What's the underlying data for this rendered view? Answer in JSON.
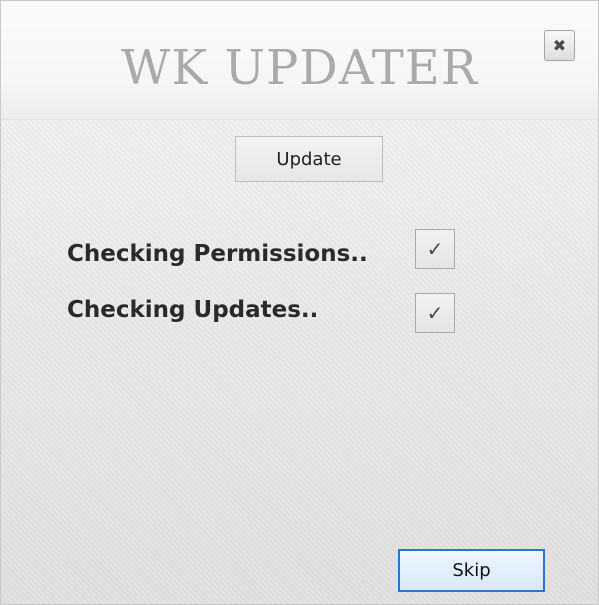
{
  "window": {
    "title": "WK UPDATER",
    "close_icon": "close-icon",
    "close_glyph": "✖"
  },
  "actions": {
    "update_label": "Update",
    "skip_label": "Skip"
  },
  "status": [
    {
      "label": "Checking Permissions..",
      "checked": true,
      "check_glyph": "✓"
    },
    {
      "label": "Checking Updates..",
      "checked": true,
      "check_glyph": "✓"
    }
  ],
  "colors": {
    "title_text": "#aaaaaa",
    "skip_border": "#2d74c8",
    "background": "#e8e8e8"
  }
}
